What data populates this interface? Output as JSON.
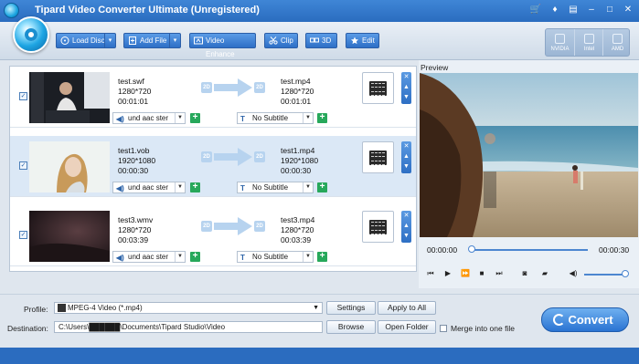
{
  "window": {
    "title": "Tipard Video Converter Ultimate (Unregistered)"
  },
  "toolbar": {
    "load_disc": "Load Disc",
    "add_file": "Add File",
    "video_enhance": "Video Enhance",
    "clip": "Clip",
    "three_d": "3D",
    "edit": "Edit"
  },
  "gpu": {
    "nvidia": "NVIDIA",
    "intel": "Intel",
    "amd": "AMD"
  },
  "files": [
    {
      "src_name": "test.swf",
      "src_res": "1280*720",
      "src_dur": "00:01:01",
      "dst_name": "test.mp4",
      "dst_res": "1280*720",
      "dst_dur": "00:01:01",
      "audio": "und aac ster",
      "subtitle": "No Subtitle",
      "selected": false
    },
    {
      "src_name": "test1.vob",
      "src_res": "1920*1080",
      "src_dur": "00:00:30",
      "dst_name": "test1.mp4",
      "dst_res": "1920*1080",
      "dst_dur": "00:00:30",
      "audio": "und aac ster",
      "subtitle": "No Subtitle",
      "selected": true
    },
    {
      "src_name": "test3.wmv",
      "src_res": "1280*720",
      "src_dur": "00:03:39",
      "dst_name": "test3.mp4",
      "dst_res": "1280*720",
      "dst_dur": "00:03:39",
      "audio": "und aac ster",
      "subtitle": "No Subtitle",
      "selected": false
    }
  ],
  "fmt_badge": "2D",
  "preview": {
    "label": "Preview",
    "time_current": "00:00:00",
    "time_total": "00:00:30",
    "progress": 0.0,
    "volume": 0.95
  },
  "bottom": {
    "profile_label": "Profile:",
    "profile_value": "MPEG-4 Video (*.mp4)",
    "settings": "Settings",
    "apply_to_all": "Apply to All",
    "destination_label": "Destination:",
    "destination_value": "C:\\Users\\██████\\Documents\\Tipard Studio\\Video",
    "browse": "Browse",
    "open_folder": "Open Folder",
    "merge_label": "Merge into one file",
    "convert": "Convert"
  }
}
